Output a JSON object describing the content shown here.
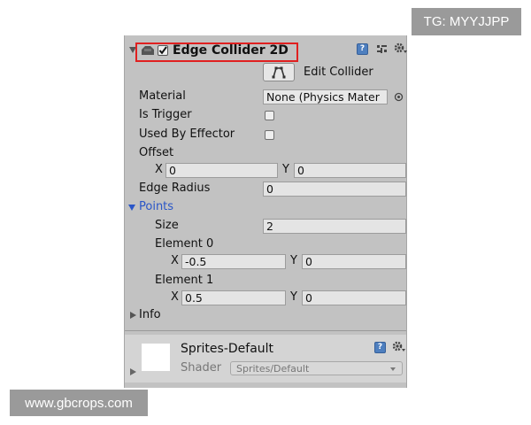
{
  "watermarks": {
    "top": "TG: MYYJJPP",
    "bottom": "www.gbcrops.com"
  },
  "component": {
    "title": "Edge Collider 2D",
    "enabled": true,
    "icons": [
      "component-icon",
      "help-icon",
      "preset-icon",
      "gear-icon"
    ],
    "edit_collider_label": "Edit Collider",
    "highlight_color": "#e02020"
  },
  "properties": {
    "material_label": "Material",
    "material_value": "None (Physics Mater",
    "is_trigger_label": "Is Trigger",
    "is_trigger": false,
    "used_by_effector_label": "Used By Effector",
    "used_by_effector": false,
    "offset_label": "Offset",
    "offset_x_label": "X",
    "offset_x": "0",
    "offset_y_label": "Y",
    "offset_y": "0",
    "edge_radius_label": "Edge Radius",
    "edge_radius": "0"
  },
  "points": {
    "label": "Points",
    "label_color": "#2a56c8",
    "size_label": "Size",
    "size": "2",
    "elements": [
      {
        "label": "Element 0",
        "x_label": "X",
        "x": "-0.5",
        "y_label": "Y",
        "y": "0"
      },
      {
        "label": "Element 1",
        "x_label": "X",
        "x": "0.5",
        "y_label": "Y",
        "y": "0"
      }
    ]
  },
  "info": {
    "label": "Info"
  },
  "material_section": {
    "name": "Sprites-Default",
    "shader_label": "Shader",
    "shader_value": "Sprites/Default"
  }
}
